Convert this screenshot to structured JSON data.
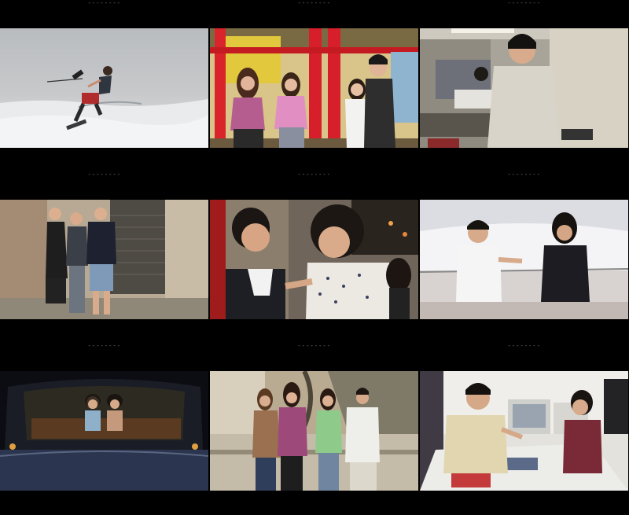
{
  "contact_sheet": {
    "frame_label": "--------",
    "frames": [
      {
        "scene": "wakeboarder-on-water"
      },
      {
        "scene": "friends-at-playground"
      },
      {
        "scene": "office-worker-back-view"
      },
      {
        "scene": "three-girls-at-shutter"
      },
      {
        "scene": "street-confrontation"
      },
      {
        "scene": "two-on-boat-deck"
      },
      {
        "scene": "girls-in-car-rear-window"
      },
      {
        "scene": "group-walking-outdoors"
      },
      {
        "scene": "office-desk-conversation"
      }
    ]
  }
}
